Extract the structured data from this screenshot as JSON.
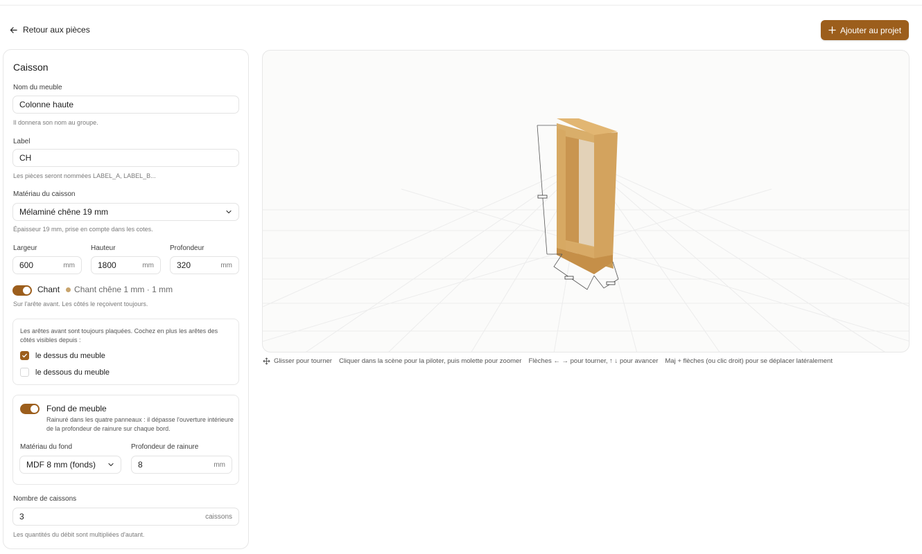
{
  "header": {
    "back_label": "Retour aux pièces",
    "add_label": "Ajouter au projet"
  },
  "panel": {
    "title": "Caisson",
    "name": {
      "label": "Nom du meuble",
      "value": "Colonne haute",
      "hint": "Il donnera son nom au groupe."
    },
    "tag": {
      "label": "Label",
      "value": "CH",
      "hint": "Les pièces seront nommées LABEL_A, LABEL_B..."
    },
    "material": {
      "label": "Matériau du caisson",
      "value": "Mélaminé chêne 19 mm",
      "hint": "Épaisseur 19 mm, prise en compte dans les cotes."
    },
    "dimensions": {
      "width": {
        "label": "Largeur",
        "value": "600",
        "unit": "mm"
      },
      "height": {
        "label": "Hauteur",
        "value": "1800",
        "unit": "mm"
      },
      "depth": {
        "label": "Profondeur",
        "value": "320",
        "unit": "mm"
      }
    },
    "edge": {
      "label": "Chant",
      "enabled": true,
      "description": "Chant chêne 1 mm · 1 mm",
      "hint": "Sur l'arête avant. Les côtés le reçoivent toujours.",
      "swatch_color": "#c8a46d"
    },
    "edges_box": {
      "text": "Les arêtes avant sont toujours plaquées. Cochez en plus les arêtes des côtés visibles depuis :",
      "options": [
        {
          "label": "le dessus du meuble",
          "checked": true
        },
        {
          "label": "le dessous du meuble",
          "checked": false
        }
      ]
    },
    "back_panel": {
      "title": "Fond de meuble",
      "enabled": true,
      "description": "Rainuré dans les quatre panneaux : il dépasse l'ouverture intérieure de la profondeur de rainure sur chaque bord.",
      "material": {
        "label": "Matériau du fond",
        "value": "MDF 8 mm (fonds)"
      },
      "groove": {
        "label": "Profondeur de rainure",
        "value": "8",
        "unit": "mm"
      }
    },
    "count": {
      "label": "Nombre de caissons",
      "value": "3",
      "unit": "caissons",
      "hint": "Les quantités du débit sont multipliées d'autant."
    }
  },
  "help": {
    "drag": "Glisser pour tourner",
    "click": "Cliquer dans la scène pour la piloter, puis molette pour zoomer",
    "arrows": "Flèches ← → pour tourner, ↑ ↓ pour avancer",
    "shift": "Maj + flèches (ou clic droit) pour se déplacer latéralement"
  },
  "colors": {
    "accent": "#9c5e1c",
    "wood": "#d6a85f"
  }
}
